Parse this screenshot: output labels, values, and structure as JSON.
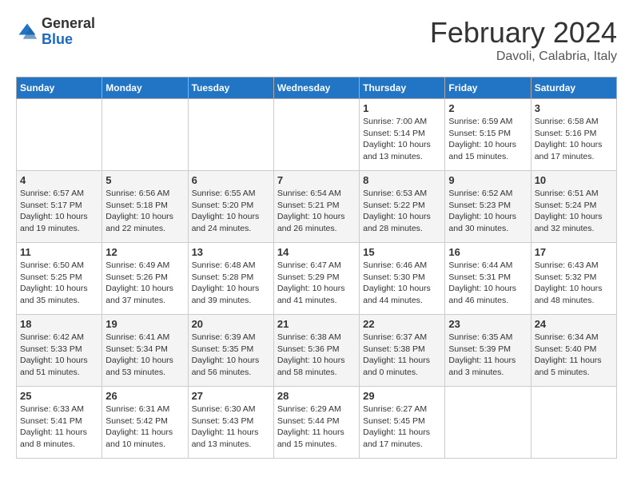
{
  "header": {
    "logo_general": "General",
    "logo_blue": "Blue",
    "month_title": "February 2024",
    "subtitle": "Davoli, Calabria, Italy"
  },
  "weekdays": [
    "Sunday",
    "Monday",
    "Tuesday",
    "Wednesday",
    "Thursday",
    "Friday",
    "Saturday"
  ],
  "weeks": [
    [
      {
        "num": "",
        "info": ""
      },
      {
        "num": "",
        "info": ""
      },
      {
        "num": "",
        "info": ""
      },
      {
        "num": "",
        "info": ""
      },
      {
        "num": "1",
        "info": "Sunrise: 7:00 AM\nSunset: 5:14 PM\nDaylight: 10 hours\nand 13 minutes."
      },
      {
        "num": "2",
        "info": "Sunrise: 6:59 AM\nSunset: 5:15 PM\nDaylight: 10 hours\nand 15 minutes."
      },
      {
        "num": "3",
        "info": "Sunrise: 6:58 AM\nSunset: 5:16 PM\nDaylight: 10 hours\nand 17 minutes."
      }
    ],
    [
      {
        "num": "4",
        "info": "Sunrise: 6:57 AM\nSunset: 5:17 PM\nDaylight: 10 hours\nand 19 minutes."
      },
      {
        "num": "5",
        "info": "Sunrise: 6:56 AM\nSunset: 5:18 PM\nDaylight: 10 hours\nand 22 minutes."
      },
      {
        "num": "6",
        "info": "Sunrise: 6:55 AM\nSunset: 5:20 PM\nDaylight: 10 hours\nand 24 minutes."
      },
      {
        "num": "7",
        "info": "Sunrise: 6:54 AM\nSunset: 5:21 PM\nDaylight: 10 hours\nand 26 minutes."
      },
      {
        "num": "8",
        "info": "Sunrise: 6:53 AM\nSunset: 5:22 PM\nDaylight: 10 hours\nand 28 minutes."
      },
      {
        "num": "9",
        "info": "Sunrise: 6:52 AM\nSunset: 5:23 PM\nDaylight: 10 hours\nand 30 minutes."
      },
      {
        "num": "10",
        "info": "Sunrise: 6:51 AM\nSunset: 5:24 PM\nDaylight: 10 hours\nand 32 minutes."
      }
    ],
    [
      {
        "num": "11",
        "info": "Sunrise: 6:50 AM\nSunset: 5:25 PM\nDaylight: 10 hours\nand 35 minutes."
      },
      {
        "num": "12",
        "info": "Sunrise: 6:49 AM\nSunset: 5:26 PM\nDaylight: 10 hours\nand 37 minutes."
      },
      {
        "num": "13",
        "info": "Sunrise: 6:48 AM\nSunset: 5:28 PM\nDaylight: 10 hours\nand 39 minutes."
      },
      {
        "num": "14",
        "info": "Sunrise: 6:47 AM\nSunset: 5:29 PM\nDaylight: 10 hours\nand 41 minutes."
      },
      {
        "num": "15",
        "info": "Sunrise: 6:46 AM\nSunset: 5:30 PM\nDaylight: 10 hours\nand 44 minutes."
      },
      {
        "num": "16",
        "info": "Sunrise: 6:44 AM\nSunset: 5:31 PM\nDaylight: 10 hours\nand 46 minutes."
      },
      {
        "num": "17",
        "info": "Sunrise: 6:43 AM\nSunset: 5:32 PM\nDaylight: 10 hours\nand 48 minutes."
      }
    ],
    [
      {
        "num": "18",
        "info": "Sunrise: 6:42 AM\nSunset: 5:33 PM\nDaylight: 10 hours\nand 51 minutes."
      },
      {
        "num": "19",
        "info": "Sunrise: 6:41 AM\nSunset: 5:34 PM\nDaylight: 10 hours\nand 53 minutes."
      },
      {
        "num": "20",
        "info": "Sunrise: 6:39 AM\nSunset: 5:35 PM\nDaylight: 10 hours\nand 56 minutes."
      },
      {
        "num": "21",
        "info": "Sunrise: 6:38 AM\nSunset: 5:36 PM\nDaylight: 10 hours\nand 58 minutes."
      },
      {
        "num": "22",
        "info": "Sunrise: 6:37 AM\nSunset: 5:38 PM\nDaylight: 11 hours\nand 0 minutes."
      },
      {
        "num": "23",
        "info": "Sunrise: 6:35 AM\nSunset: 5:39 PM\nDaylight: 11 hours\nand 3 minutes."
      },
      {
        "num": "24",
        "info": "Sunrise: 6:34 AM\nSunset: 5:40 PM\nDaylight: 11 hours\nand 5 minutes."
      }
    ],
    [
      {
        "num": "25",
        "info": "Sunrise: 6:33 AM\nSunset: 5:41 PM\nDaylight: 11 hours\nand 8 minutes."
      },
      {
        "num": "26",
        "info": "Sunrise: 6:31 AM\nSunset: 5:42 PM\nDaylight: 11 hours\nand 10 minutes."
      },
      {
        "num": "27",
        "info": "Sunrise: 6:30 AM\nSunset: 5:43 PM\nDaylight: 11 hours\nand 13 minutes."
      },
      {
        "num": "28",
        "info": "Sunrise: 6:29 AM\nSunset: 5:44 PM\nDaylight: 11 hours\nand 15 minutes."
      },
      {
        "num": "29",
        "info": "Sunrise: 6:27 AM\nSunset: 5:45 PM\nDaylight: 11 hours\nand 17 minutes."
      },
      {
        "num": "",
        "info": ""
      },
      {
        "num": "",
        "info": ""
      }
    ]
  ]
}
